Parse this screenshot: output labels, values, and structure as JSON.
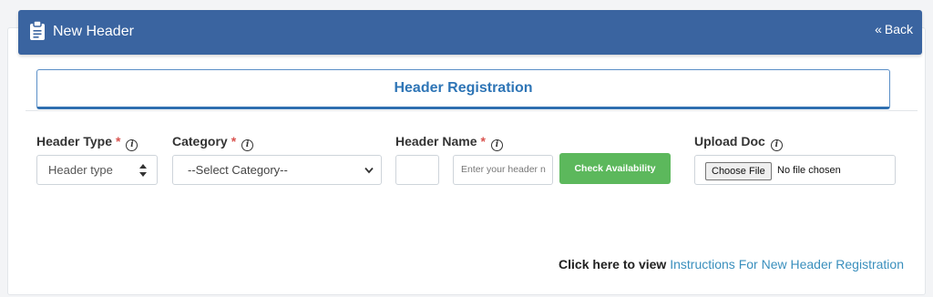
{
  "header": {
    "title": "New Header",
    "back_label": "Back",
    "icon": "clipboard-icon",
    "color": "#3a64a0"
  },
  "tabs": [
    {
      "label": "Header Registration"
    }
  ],
  "form": {
    "header_type": {
      "label": "Header Type",
      "required_mark": "*",
      "value": "Header type"
    },
    "category": {
      "label": "Category",
      "required_mark": "*",
      "value": "--Select Category--"
    },
    "header_name": {
      "label": "Header Name",
      "required_mark": "*",
      "prefix_value": "",
      "placeholder": "Enter your header n"
    },
    "check_button": "Check Availability",
    "upload": {
      "label": "Upload Doc",
      "button": "Choose File",
      "status": "No file chosen"
    }
  },
  "footer": {
    "prefix": "Click here to view",
    "link": "Instructions For New Header Registration"
  },
  "colors": {
    "accent": "#2e75b6",
    "success": "#5cb85c",
    "required": "#d9534f",
    "link": "#3a8fbd"
  }
}
